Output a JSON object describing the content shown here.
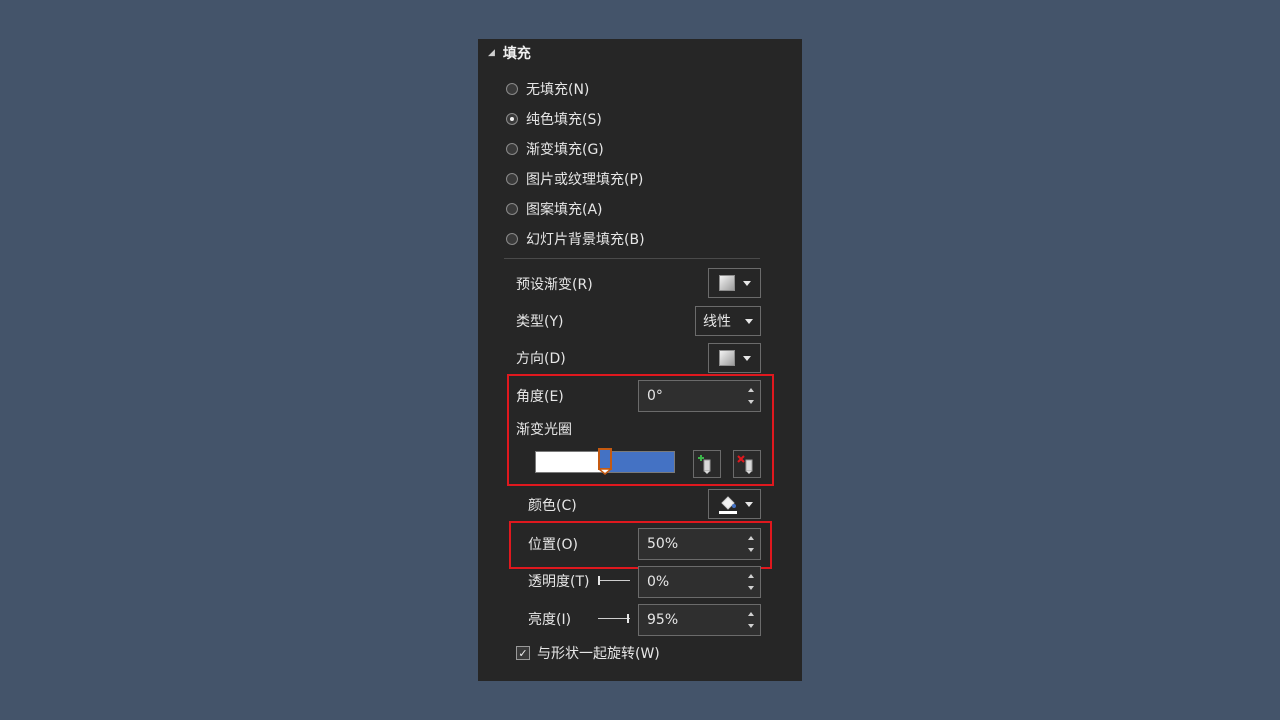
{
  "section": {
    "title": "填充"
  },
  "fill_options": [
    {
      "label": "无填充(N)",
      "checked": false
    },
    {
      "label": "纯色填充(S)",
      "checked": true
    },
    {
      "label": "渐变填充(G)",
      "checked": false
    },
    {
      "label": "图片或纹理填充(P)",
      "checked": false
    },
    {
      "label": "图案填充(A)",
      "checked": false
    },
    {
      "label": "幻灯片背景填充(B)",
      "checked": false
    }
  ],
  "preset": {
    "label": "预设渐变(R)"
  },
  "type": {
    "label": "类型(Y)",
    "value": "线性"
  },
  "direction": {
    "label": "方向(D)"
  },
  "angle": {
    "label": "角度(E)",
    "value": "0°"
  },
  "gradient_stops": {
    "label": "渐变光圈",
    "colors": [
      "#ffffff",
      "#4472c4"
    ],
    "selected_stop_position": 0.5
  },
  "color": {
    "label": "颜色(C)"
  },
  "position": {
    "label": "位置(O)",
    "value": "50%"
  },
  "transparency": {
    "label": "透明度(T)",
    "value": "0%",
    "level": 0
  },
  "brightness": {
    "label": "亮度(I)",
    "value": "95%",
    "level": 0.95
  },
  "rotate_with_shape": {
    "label": "与形状一起旋转(W)",
    "checked": true
  },
  "colors": {
    "background": "#44546a",
    "panel": "#262626",
    "highlight": "#e0181e",
    "accent_stop": "#4472c4",
    "stop_outline": "#c55a11"
  }
}
